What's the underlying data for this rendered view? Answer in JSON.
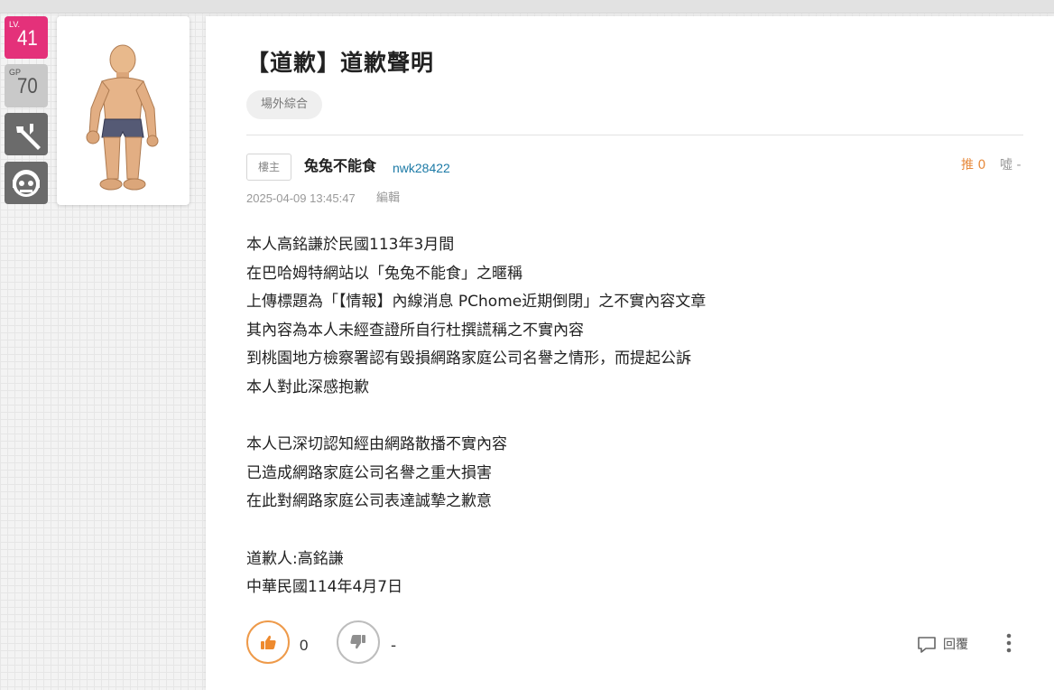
{
  "sidebar": {
    "level": {
      "caption": "LV.",
      "value": "41"
    },
    "gp": {
      "caption": "GP",
      "value": "70"
    },
    "tool_icon": "wrench-icon",
    "face_icon": "face-icon"
  },
  "colors": {
    "level_badge": "#e4317a",
    "push": "#e78a3c",
    "author_id": "#1c7aa6"
  },
  "post": {
    "title": "【道歉】道歉聲明",
    "board_tag": "場外綜合",
    "op_tag": "樓主",
    "author_name": "兔兔不能食",
    "author_id": "nwk28422",
    "push_label": "推 0",
    "boo_label": "噓 -",
    "timestamp": "2025-04-09 13:45:47",
    "edit_label": "編輯",
    "paragraphs": [
      [
        "本人高銘謙於民國113年3月間",
        "在巴哈姆特網站以「兔兔不能食」之暱稱",
        "上傳標題為「【情報】內線消息 PChome近期倒閉」之不實內容文章",
        "其內容為本人未經查證所自行杜撰謊稱之不實內容",
        "到桃園地方檢察署認有毀損網路家庭公司名譽之情形，而提起公訴",
        "本人對此深感抱歉"
      ],
      [
        "本人已深切認知經由網路散播不實內容",
        "已造成網路家庭公司名譽之重大損害",
        "在此對網路家庭公司表達誠摯之歉意"
      ],
      [
        "道歉人:高銘謙",
        "中華民國114年4月7日"
      ]
    ]
  },
  "footer": {
    "like_count": "0",
    "dislike_count": "-",
    "reply_label": "回覆",
    "like_icon": "thumbs-up-icon",
    "dislike_icon": "thumbs-down-icon",
    "reply_icon": "comment-icon",
    "more_icon": "more-vertical-icon"
  }
}
